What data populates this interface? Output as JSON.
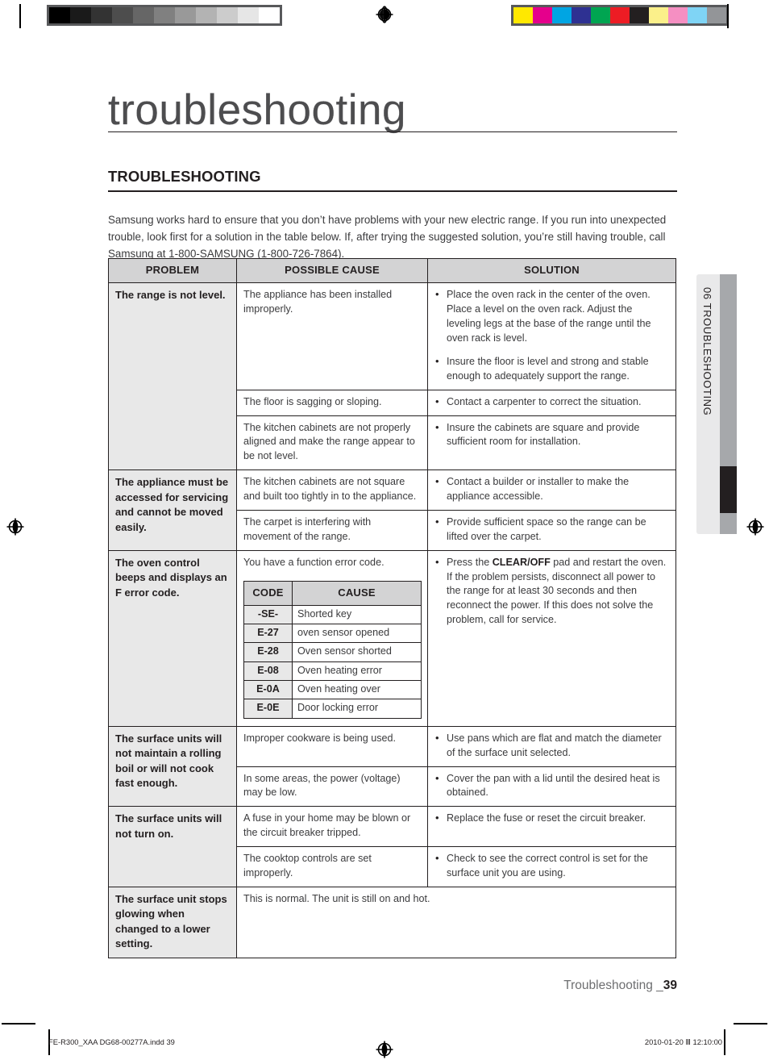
{
  "print_marks": {
    "grayscale_swatches": [
      "#000000",
      "#1a1a1a",
      "#333333",
      "#4d4d4d",
      "#666666",
      "#808080",
      "#999999",
      "#b3b3b3",
      "#cccccc",
      "#e6e6e6",
      "#ffffff"
    ],
    "color_swatches": [
      "#ffe800",
      "#e5008c",
      "#00a5e3",
      "#2e3192",
      "#00a551",
      "#ed1c24",
      "#231f20",
      "#fbf08a",
      "#f municipality",
      "#7fd4f5",
      "#939598"
    ],
    "color_swatches_fixed": [
      "#ffe800",
      "#e5008c",
      "#00a5e3",
      "#2e3192",
      "#00a551",
      "#ed1c24",
      "#231f20",
      "#fbf08a",
      "#f58fc2",
      "#7fd4f5",
      "#939598"
    ],
    "registration_icon": "registration-target-icon"
  },
  "document": {
    "title": "troubleshooting",
    "section_heading": "TROUBLESHOOTING",
    "intro": "Samsung works hard to ensure that you don’t have problems with your new electric range. If you run into unexpected trouble, look first for a solution in the table below. If, after trying the suggested solution, you’re still having trouble, call Samsung at 1-800-SAMSUNG (1-800-726-7864)."
  },
  "side_tab": {
    "chapter_number": "06",
    "chapter_name": "TROUBLESHOOTING",
    "label": "06  TROUBLESHOOTING"
  },
  "table": {
    "headers": {
      "problem": "PROBLEM",
      "cause": "POSSIBLE CAUSE",
      "solution": "SOLUTION"
    },
    "rows": [
      {
        "problem": "The range is not level.",
        "entries": [
          {
            "cause": "The appliance has been installed improperly.",
            "solutions": [
              "Place the oven rack in the center of the oven. Place a level on the oven rack. Adjust the leveling legs at the base of the range until the oven rack is level.",
              "Insure the floor is level and strong and stable enough to adequately support the range."
            ]
          },
          {
            "cause": "The floor is sagging or sloping.",
            "solutions": [
              "Contact a carpenter to correct the situation."
            ]
          },
          {
            "cause": "The kitchen cabinets are not properly aligned and make the range appear to be not level.",
            "solutions": [
              "Insure the cabinets are square and provide sufficient room for installation."
            ]
          }
        ]
      },
      {
        "problem": "The appliance must be accessed for servicing and cannot be moved easily.",
        "entries": [
          {
            "cause": "The kitchen cabinets are not square and built too tightly in to the appliance.",
            "solutions": [
              "Contact a builder or installer to make the appliance accessible."
            ]
          },
          {
            "cause": "The carpet is interfering with movement of the range.",
            "solutions": [
              "Provide sufficient space so the range can be lifted over the carpet."
            ]
          }
        ]
      },
      {
        "problem": "The oven control beeps and displays an F error code.",
        "entries": [
          {
            "cause": "You have a function error code.",
            "solution_rich": {
              "pre": "Press the ",
              "bold": "CLEAR/OFF",
              "post": " pad and restart the oven. If the problem persists, disconnect all power to the range for at least 30 seconds and then reconnect the power. If this does not solve the problem, call for service."
            },
            "error_table": {
              "headers": {
                "code": "CODE",
                "cause": "CAUSE"
              },
              "rows": [
                {
                  "code": "-SE-",
                  "cause": "Shorted key"
                },
                {
                  "code": "E-27",
                  "cause": "oven sensor opened"
                },
                {
                  "code": "E-28",
                  "cause": "Oven sensor shorted"
                },
                {
                  "code": "E-08",
                  "cause": "Oven heating error"
                },
                {
                  "code": "E-0A",
                  "cause": "Oven heating over"
                },
                {
                  "code": "E-0E",
                  "cause": "Door locking error"
                }
              ]
            }
          }
        ]
      },
      {
        "problem": "The surface units will not maintain a rolling boil or will not cook fast enough.",
        "entries": [
          {
            "cause": "Improper cookware is being used.",
            "solutions": [
              "Use pans which are flat and match the diameter of the surface unit selected."
            ]
          },
          {
            "cause": "In some areas, the power (voltage) may be low.",
            "solutions": [
              "Cover the pan with a lid until the desired heat is obtained."
            ]
          }
        ]
      },
      {
        "problem": "The surface units will not turn on.",
        "entries": [
          {
            "cause": "A fuse in your home may be blown or the circuit breaker tripped.",
            "solutions": [
              "Replace the fuse or reset the circuit breaker."
            ]
          },
          {
            "cause": "The cooktop controls are set improperly.",
            "solutions": [
              "Check to see the correct control is set for the surface unit you are using."
            ]
          }
        ]
      },
      {
        "problem": "The surface unit stops glowing when changed to a lower setting.",
        "entries": [
          {
            "cause_span": "This is normal. The unit is still on and hot."
          }
        ]
      }
    ]
  },
  "footer": {
    "section_label": "Troubleshooting _",
    "page_number": "39",
    "print_file": "FE-R300_XAA DG68-00277A.indd   39",
    "print_timestamp": "2010-01-20   Ⅲ 12:10:00"
  }
}
